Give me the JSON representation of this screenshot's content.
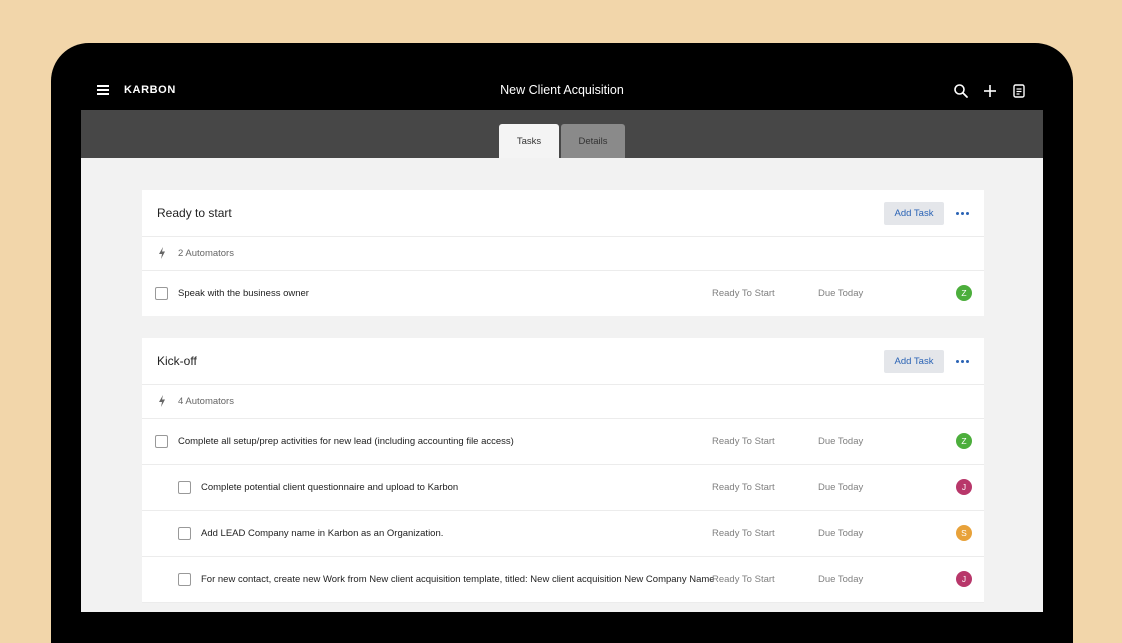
{
  "app": {
    "brand": "KARBON",
    "title": "New Client Acquisition"
  },
  "icons": {
    "menu": "hamburger-menu-icon",
    "search": "search-icon",
    "add": "plus-icon",
    "notes": "notes-icon",
    "automator": "lightning-bolt-icon",
    "more": "more-dots-icon"
  },
  "colors": {
    "background": "#f2d6aa",
    "topbar": "#000000",
    "subbar": "#474747",
    "accent": "#2a63b5"
  },
  "tabs": [
    {
      "label": "Tasks",
      "active": true
    },
    {
      "label": "Details",
      "active": false
    }
  ],
  "sections": [
    {
      "title": "Ready to start",
      "add_label": "Add Task",
      "automators": "2 Automators",
      "tasks": [
        {
          "name": "Speak with the business owner",
          "status": "Ready To Start",
          "due": "Due Today",
          "avatar": "Z",
          "avatar_color": "#4cae3c"
        }
      ]
    },
    {
      "title": "Kick-off",
      "add_label": "Add Task",
      "automators": "4 Automators",
      "tasks": [
        {
          "name": "Complete all setup/prep activities for new lead (including accounting file access)",
          "status": "Ready To Start",
          "due": "Due Today",
          "avatar": "Z",
          "avatar_color": "#4cae3c"
        },
        {
          "name": "Complete potential client questionnaire and upload to Karbon",
          "status": "Ready To Start",
          "due": "Due Today",
          "avatar": "J",
          "avatar_color": "#b8376a"
        },
        {
          "name": "Add LEAD Company name in Karbon as an Organization.",
          "status": "Ready To Start",
          "due": "Due Today",
          "avatar": "S",
          "avatar_color": "#e8a23a"
        },
        {
          "name": "For new contact, create new Work from New client acquisition template, titled: New client acquisition New Company Name",
          "status": "Ready To Start",
          "due": "Due Today",
          "avatar": "J",
          "avatar_color": "#b8376a"
        }
      ]
    }
  ]
}
